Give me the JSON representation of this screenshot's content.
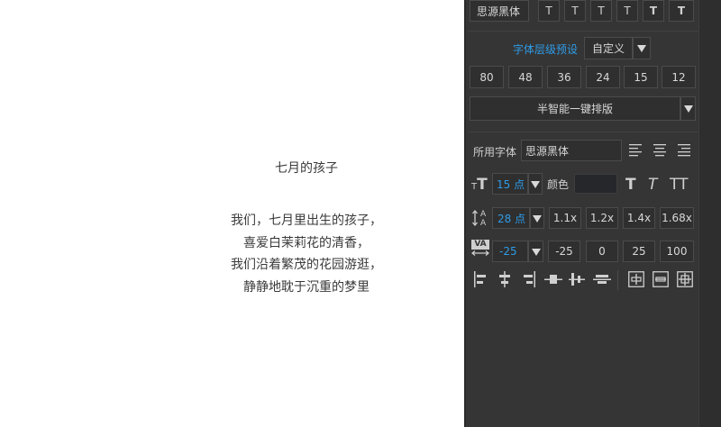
{
  "poem": {
    "title": "七月的孩子",
    "lines": [
      "我们，七月里出生的孩子，",
      "喜爱白茉莉花的清香，",
      "我们沿着繁茂的花园游逛，",
      "静静地耽于沉重的梦里"
    ]
  },
  "panel": {
    "top_font_value": "思源黑体",
    "style_buttons": [
      "T",
      "T",
      "T",
      "T",
      "T",
      "T"
    ],
    "preset_label": "字体层级预设",
    "preset_value": "自定义",
    "size_presets": [
      "80",
      "48",
      "36",
      "24",
      "15",
      "12"
    ],
    "auto_layout_label": "半智能一键排版",
    "used_font_label": "所用字体",
    "used_font_value": "思源黑体",
    "font_size_value": "15 点",
    "color_label": "颜色",
    "color_value": "#25272b",
    "line_height_value": "28 点",
    "line_height_presets": [
      "1.1x",
      "1.2x",
      "1.4x",
      "1.68x"
    ],
    "tracking_value": "-25",
    "tracking_presets": [
      "-25",
      "0",
      "25",
      "100"
    ],
    "text_style_glyphs": [
      "T",
      "T",
      "TT"
    ],
    "va_icon_text": "VA"
  }
}
